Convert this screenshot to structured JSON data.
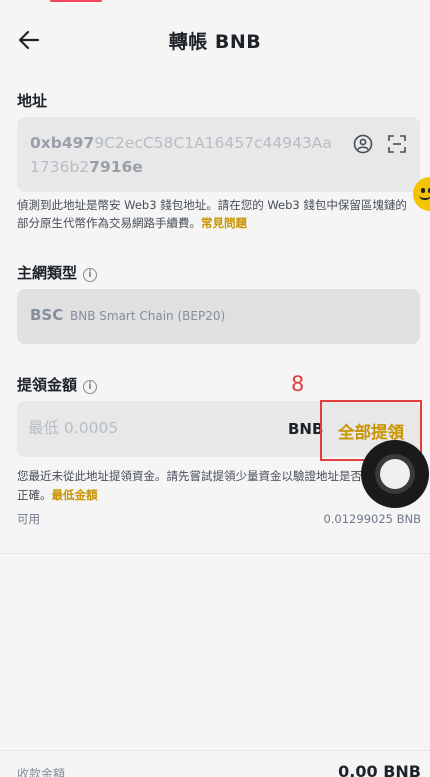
{
  "header": {
    "title": "轉帳 BNB"
  },
  "address": {
    "label": "地址",
    "value_start": "0xb497",
    "value_middle": "9C2ecC58C1A16457c44943Aa1736b2",
    "value_end": "7916e",
    "value_bold_mid": "27916e"
  },
  "notice": {
    "text": "偵測到此地址是幣安 Web3 錢包地址。請在您的 Web3 錢包中保留區塊鏈的部分原生代幣作為交易網路手續費。",
    "link": "常見問題"
  },
  "network": {
    "label": "主網類型",
    "code": "BSC",
    "name": "BNB Smart Chain (BEP20)"
  },
  "amount": {
    "label": "提領金額",
    "placeholder": "最低 0.0005",
    "unit": "BNB",
    "max_button": "全部提領",
    "marker": "8"
  },
  "warning": {
    "text": "您最近未從此地址提領資金。請先嘗試提領少量資金以驗證地址是否正確。",
    "link": "最低金額"
  },
  "available": {
    "label": "可用",
    "value": "0.01299025 BNB"
  },
  "receive": {
    "label": "收款金額",
    "value": "0.00 BNB"
  },
  "colors": {
    "accent": "#c99400",
    "highlight_border": "#e33d3d",
    "background": "#f5f5f5"
  }
}
